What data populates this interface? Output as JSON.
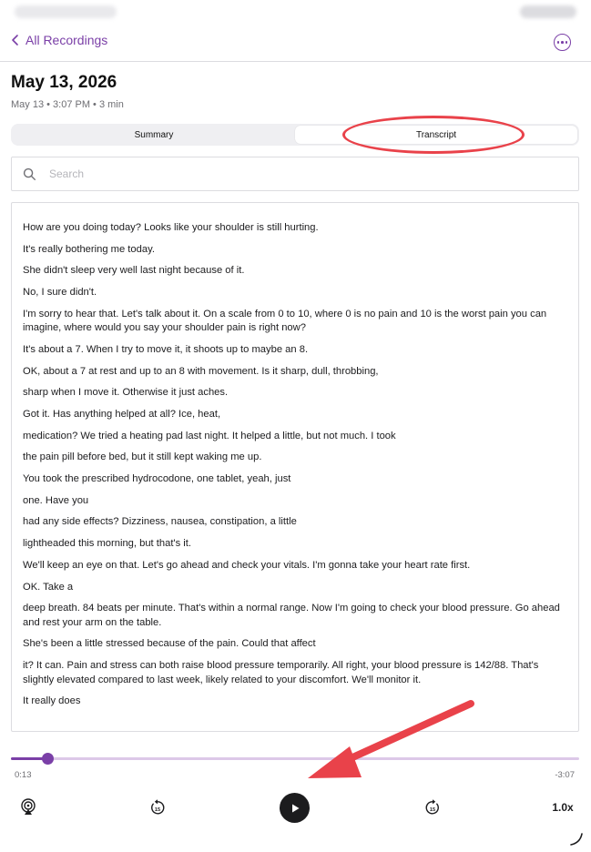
{
  "nav": {
    "back_label": "All Recordings"
  },
  "recording": {
    "title": "May 13, 2026",
    "meta": "May 13 • 3:07 PM • 3 min"
  },
  "tabs": [
    {
      "label": "Summary",
      "selected": false
    },
    {
      "label": "Transcript",
      "selected": true
    }
  ],
  "search": {
    "placeholder": "Search",
    "value": ""
  },
  "transcript": [
    "How are you doing today? Looks like your shoulder is still hurting.",
    "It's really bothering me today.",
    "She didn't sleep very well last night because of it.",
    "No, I sure didn't.",
    "I'm sorry to hear that. Let's talk about it. On a scale from 0 to 10, where 0 is no pain and 10 is the worst pain you can imagine, where would you say your shoulder pain is right now?",
    "It's about a 7. When I try to move it, it shoots up to maybe an 8.",
    "OK, about a 7 at rest and up to an 8 with movement. Is it sharp, dull, throbbing,",
    "sharp when I move it. Otherwise it just aches.",
    "Got it. Has anything helped at all? Ice, heat,",
    "medication? We tried a heating pad last night. It helped a little, but not much. I took",
    "the pain pill before bed, but it still kept waking me up.",
    "You took the prescribed hydrocodone, one tablet, yeah, just",
    "one. Have you",
    "had any side effects? Dizziness, nausea, constipation, a little",
    "lightheaded this morning, but that's it.",
    "We'll keep an eye on that. Let's go ahead and check your vitals. I'm gonna take your heart rate first.",
    "OK. Take a",
    "deep breath. 84 beats per minute. That's within a normal range. Now I'm going to check your blood pressure. Go ahead and rest your arm on the table.",
    "She's been a little stressed because of the pain. Could that affect",
    "it? It can. Pain and stress can both raise blood pressure temporarily. All right, your blood pressure is 142/88. That's slightly elevated compared to last week, likely related to your discomfort. We'll monitor it.",
    "It really does"
  ],
  "player": {
    "elapsed": "0:13",
    "remaining": "-3:07",
    "progress_fraction": 0.065,
    "speed": "1.0x"
  },
  "colors": {
    "accent": "#7a3fa7",
    "annotation": "#e9424a"
  },
  "icons": [
    "chevron-left-icon",
    "more-icon",
    "search-icon",
    "airplay-icon",
    "rewind-15-icon",
    "play-icon",
    "forward-15-icon"
  ]
}
